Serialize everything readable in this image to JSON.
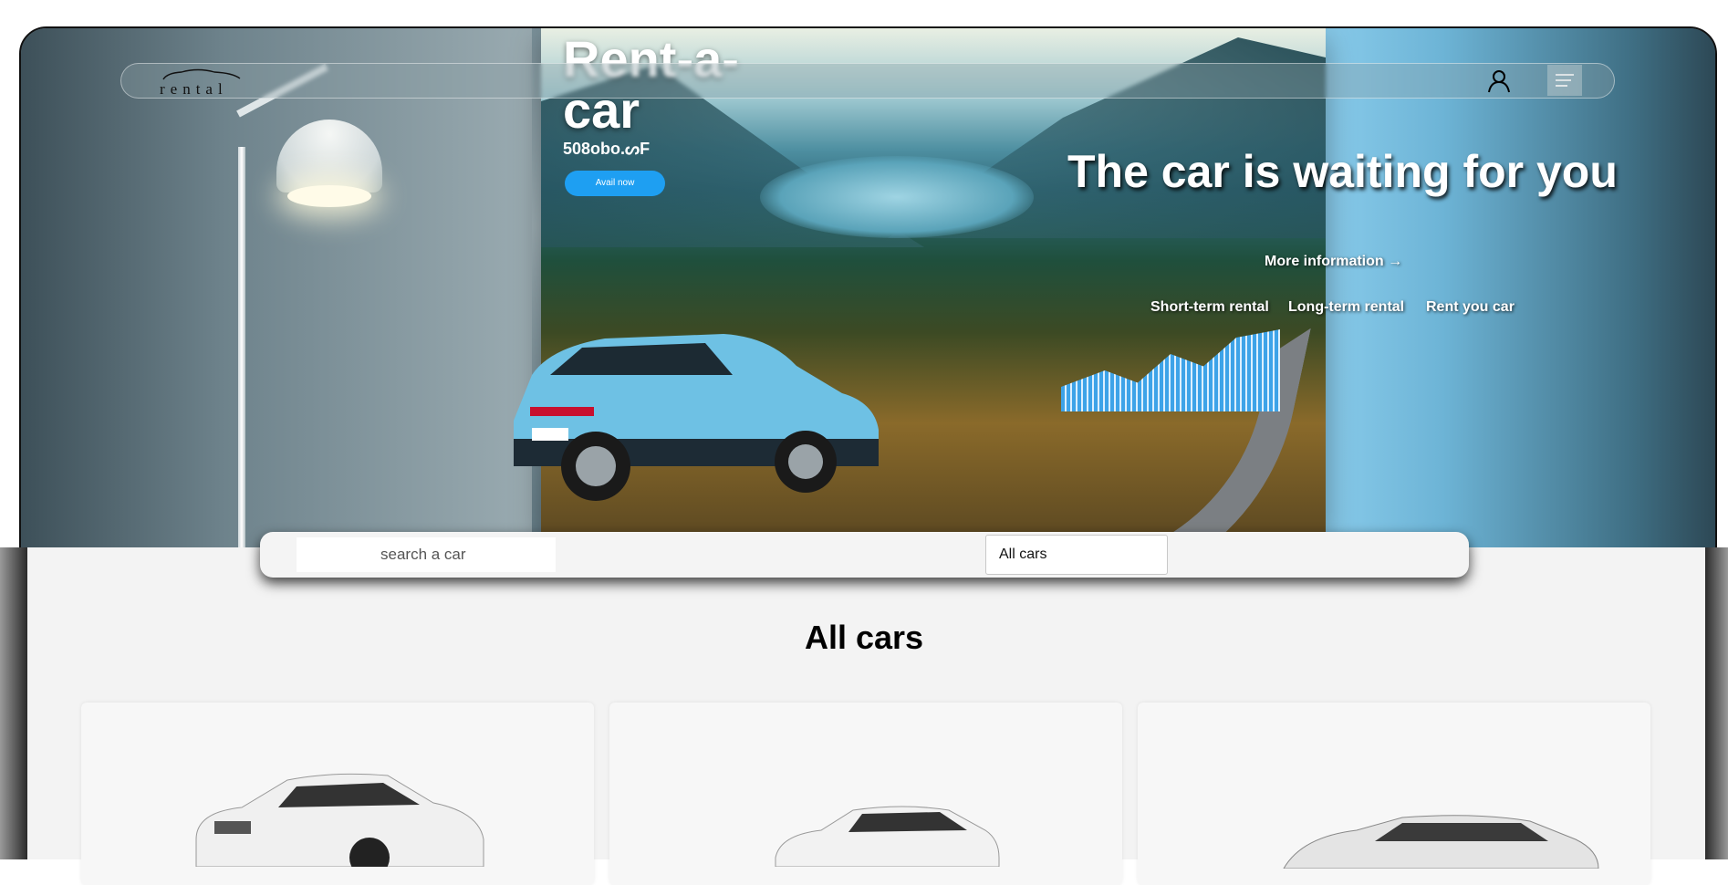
{
  "navbar": {
    "logo_text": "rental",
    "logo_icon": "car-outline-icon",
    "user_icon": "user-icon",
    "menu_icon": "menu-icon"
  },
  "poster": {
    "title": "Rent-a-car",
    "subtitle": "508obo.ᔕF",
    "button": "Avail now"
  },
  "hero": {
    "title": "The car is waiting for you",
    "more_info": "More information →",
    "links": [
      "Short-term rental",
      "Long-term rental",
      "Rent you car"
    ]
  },
  "search": {
    "placeholder": "search a car",
    "filter_selected": "All cars"
  },
  "main": {
    "section_title": "All cars",
    "cards": [
      {
        "image": "white-coupe-car"
      },
      {
        "image": "white-hatchback-car"
      },
      {
        "image": "white-sedan-car"
      }
    ]
  },
  "colors": {
    "accent_blue": "#1e9ff2",
    "content_bg": "#f3f3f3"
  }
}
